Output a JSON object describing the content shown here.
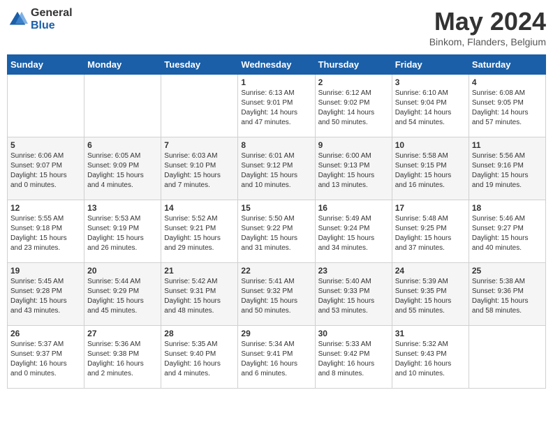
{
  "header": {
    "logo": {
      "general": "General",
      "blue": "Blue"
    },
    "title": "May 2024",
    "location": "Binkom, Flanders, Belgium"
  },
  "calendar": {
    "days_of_week": [
      "Sunday",
      "Monday",
      "Tuesday",
      "Wednesday",
      "Thursday",
      "Friday",
      "Saturday"
    ],
    "weeks": [
      [
        {
          "day": "",
          "info": ""
        },
        {
          "day": "",
          "info": ""
        },
        {
          "day": "",
          "info": ""
        },
        {
          "day": "1",
          "info": "Sunrise: 6:13 AM\nSunset: 9:01 PM\nDaylight: 14 hours\nand 47 minutes."
        },
        {
          "day": "2",
          "info": "Sunrise: 6:12 AM\nSunset: 9:02 PM\nDaylight: 14 hours\nand 50 minutes."
        },
        {
          "day": "3",
          "info": "Sunrise: 6:10 AM\nSunset: 9:04 PM\nDaylight: 14 hours\nand 54 minutes."
        },
        {
          "day": "4",
          "info": "Sunrise: 6:08 AM\nSunset: 9:05 PM\nDaylight: 14 hours\nand 57 minutes."
        }
      ],
      [
        {
          "day": "5",
          "info": "Sunrise: 6:06 AM\nSunset: 9:07 PM\nDaylight: 15 hours\nand 0 minutes."
        },
        {
          "day": "6",
          "info": "Sunrise: 6:05 AM\nSunset: 9:09 PM\nDaylight: 15 hours\nand 4 minutes."
        },
        {
          "day": "7",
          "info": "Sunrise: 6:03 AM\nSunset: 9:10 PM\nDaylight: 15 hours\nand 7 minutes."
        },
        {
          "day": "8",
          "info": "Sunrise: 6:01 AM\nSunset: 9:12 PM\nDaylight: 15 hours\nand 10 minutes."
        },
        {
          "day": "9",
          "info": "Sunrise: 6:00 AM\nSunset: 9:13 PM\nDaylight: 15 hours\nand 13 minutes."
        },
        {
          "day": "10",
          "info": "Sunrise: 5:58 AM\nSunset: 9:15 PM\nDaylight: 15 hours\nand 16 minutes."
        },
        {
          "day": "11",
          "info": "Sunrise: 5:56 AM\nSunset: 9:16 PM\nDaylight: 15 hours\nand 19 minutes."
        }
      ],
      [
        {
          "day": "12",
          "info": "Sunrise: 5:55 AM\nSunset: 9:18 PM\nDaylight: 15 hours\nand 23 minutes."
        },
        {
          "day": "13",
          "info": "Sunrise: 5:53 AM\nSunset: 9:19 PM\nDaylight: 15 hours\nand 26 minutes."
        },
        {
          "day": "14",
          "info": "Sunrise: 5:52 AM\nSunset: 9:21 PM\nDaylight: 15 hours\nand 29 minutes."
        },
        {
          "day": "15",
          "info": "Sunrise: 5:50 AM\nSunset: 9:22 PM\nDaylight: 15 hours\nand 31 minutes."
        },
        {
          "day": "16",
          "info": "Sunrise: 5:49 AM\nSunset: 9:24 PM\nDaylight: 15 hours\nand 34 minutes."
        },
        {
          "day": "17",
          "info": "Sunrise: 5:48 AM\nSunset: 9:25 PM\nDaylight: 15 hours\nand 37 minutes."
        },
        {
          "day": "18",
          "info": "Sunrise: 5:46 AM\nSunset: 9:27 PM\nDaylight: 15 hours\nand 40 minutes."
        }
      ],
      [
        {
          "day": "19",
          "info": "Sunrise: 5:45 AM\nSunset: 9:28 PM\nDaylight: 15 hours\nand 43 minutes."
        },
        {
          "day": "20",
          "info": "Sunrise: 5:44 AM\nSunset: 9:29 PM\nDaylight: 15 hours\nand 45 minutes."
        },
        {
          "day": "21",
          "info": "Sunrise: 5:42 AM\nSunset: 9:31 PM\nDaylight: 15 hours\nand 48 minutes."
        },
        {
          "day": "22",
          "info": "Sunrise: 5:41 AM\nSunset: 9:32 PM\nDaylight: 15 hours\nand 50 minutes."
        },
        {
          "day": "23",
          "info": "Sunrise: 5:40 AM\nSunset: 9:33 PM\nDaylight: 15 hours\nand 53 minutes."
        },
        {
          "day": "24",
          "info": "Sunrise: 5:39 AM\nSunset: 9:35 PM\nDaylight: 15 hours\nand 55 minutes."
        },
        {
          "day": "25",
          "info": "Sunrise: 5:38 AM\nSunset: 9:36 PM\nDaylight: 15 hours\nand 58 minutes."
        }
      ],
      [
        {
          "day": "26",
          "info": "Sunrise: 5:37 AM\nSunset: 9:37 PM\nDaylight: 16 hours\nand 0 minutes."
        },
        {
          "day": "27",
          "info": "Sunrise: 5:36 AM\nSunset: 9:38 PM\nDaylight: 16 hours\nand 2 minutes."
        },
        {
          "day": "28",
          "info": "Sunrise: 5:35 AM\nSunset: 9:40 PM\nDaylight: 16 hours\nand 4 minutes."
        },
        {
          "day": "29",
          "info": "Sunrise: 5:34 AM\nSunset: 9:41 PM\nDaylight: 16 hours\nand 6 minutes."
        },
        {
          "day": "30",
          "info": "Sunrise: 5:33 AM\nSunset: 9:42 PM\nDaylight: 16 hours\nand 8 minutes."
        },
        {
          "day": "31",
          "info": "Sunrise: 5:32 AM\nSunset: 9:43 PM\nDaylight: 16 hours\nand 10 minutes."
        },
        {
          "day": "",
          "info": ""
        }
      ]
    ]
  }
}
